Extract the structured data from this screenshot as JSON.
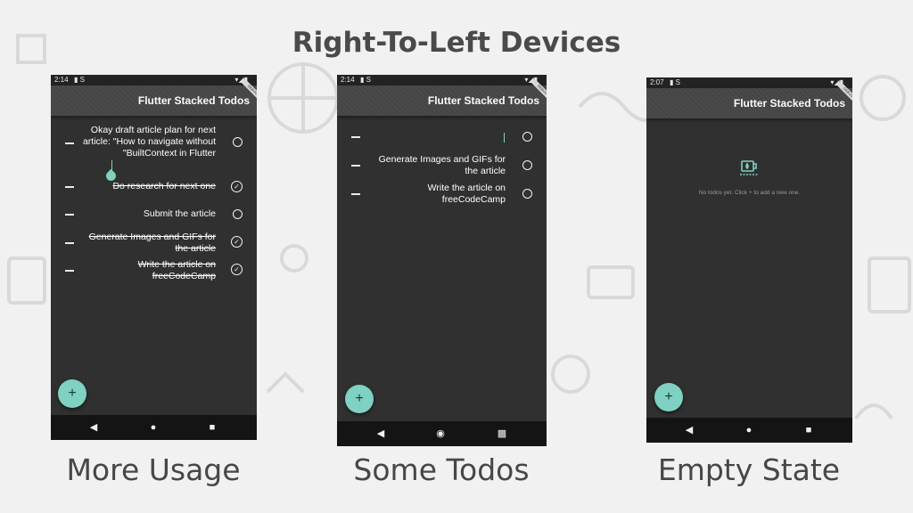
{
  "header": {
    "title": "Right-To-Left Devices"
  },
  "colors": {
    "accent": "#7fd1c1",
    "surface": "#303030",
    "appbar": "#494949",
    "navbar": "#141414"
  },
  "phones": [
    {
      "caption": "More Usage",
      "status": {
        "time": "2:14",
        "left_icons": "▮ S",
        "right_icons": "▾◢▮"
      },
      "appbar_title": "Flutter Stacked Todos",
      "debug_banner": "DEBUG",
      "todos": [
        {
          "text": "Okay draft article plan for next article: \"How to navigate without \"BuiltContext in Flutter",
          "done": false,
          "state_icon": "circle-icon"
        },
        {
          "text": "Do research for next one",
          "done": true,
          "state_icon": "check-circle-icon"
        },
        {
          "text": "Submit the article",
          "done": false,
          "state_icon": "circle-icon"
        },
        {
          "text": "Generate Images and GIFs for the article",
          "done": true,
          "state_icon": "check-circle-icon"
        },
        {
          "text": "Write the article on freeCodeCamp",
          "done": true,
          "state_icon": "check-circle-icon"
        }
      ],
      "fab_label": "+",
      "nav": {
        "back": "◀",
        "home": "●",
        "recents": "■"
      }
    },
    {
      "caption": "Some Todos",
      "status": {
        "time": "2:14",
        "left_icons": "▮ S",
        "right_icons": "▾◢▮"
      },
      "appbar_title": "Flutter Stacked Todos",
      "debug_banner": "DEBUG",
      "todos": [
        {
          "text": "",
          "done": false,
          "state_icon": "circle-icon"
        },
        {
          "text": "Generate Images and GIFs for the article",
          "done": false,
          "state_icon": "circle-icon"
        },
        {
          "text": "Write the article on freeCodeCamp",
          "done": false,
          "state_icon": "circle-icon"
        }
      ],
      "fab_label": "+",
      "nav": {
        "back": "◀",
        "home": "◉",
        "recents": "▩"
      }
    },
    {
      "caption": "Empty State",
      "status": {
        "time": "2:07",
        "left_icons": "▮ S",
        "right_icons": "▾◢▮"
      },
      "appbar_title": "Flutter Stacked Todos",
      "debug_banner": "DEBUG",
      "todos": [],
      "empty_icon": "coffee-cup-icon",
      "empty_message": "No todos yet. Click + to add a new one.",
      "fab_label": "+",
      "nav": {
        "back": "◀",
        "home": "●",
        "recents": "■"
      }
    }
  ]
}
